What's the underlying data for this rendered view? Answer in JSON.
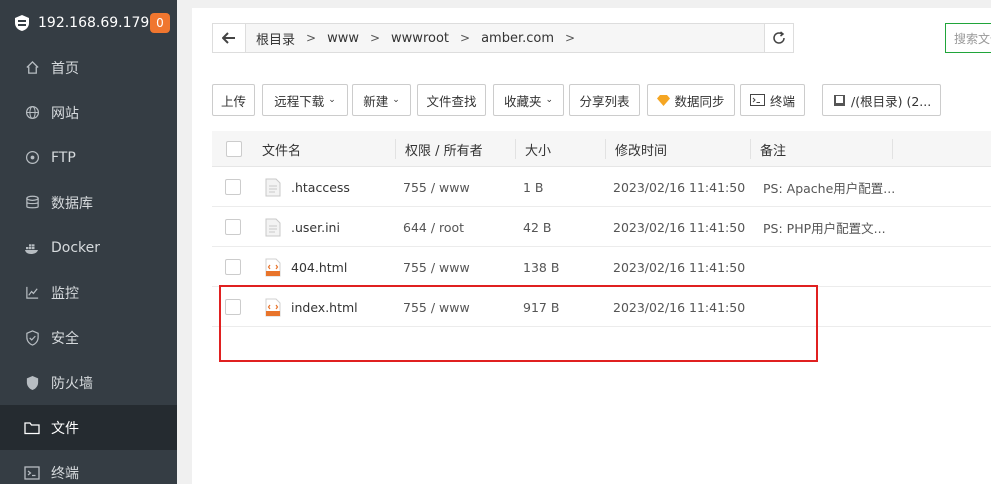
{
  "sidebar": {
    "ip": "192.168.69.179",
    "badge": "0",
    "items": [
      {
        "label": "首页",
        "icon": "home-icon"
      },
      {
        "label": "网站",
        "icon": "globe-icon"
      },
      {
        "label": "FTP",
        "icon": "ftp-icon"
      },
      {
        "label": "数据库",
        "icon": "database-icon"
      },
      {
        "label": "Docker",
        "icon": "docker-icon"
      },
      {
        "label": "监控",
        "icon": "monitor-icon"
      },
      {
        "label": "安全",
        "icon": "shield-icon"
      },
      {
        "label": "防火墙",
        "icon": "firewall-icon"
      },
      {
        "label": "文件",
        "icon": "folder-icon",
        "active": true
      },
      {
        "label": "终端",
        "icon": "terminal-icon"
      }
    ]
  },
  "path": {
    "crumbs": [
      "根目录",
      "www",
      "wwwroot",
      "amber.com"
    ]
  },
  "search": {
    "placeholder": "搜索文件"
  },
  "toolbar": {
    "upload": "上传",
    "remote_download": "远程下载",
    "new": "新建",
    "file_search": "文件查找",
    "favorites": "收藏夹",
    "share_list": "分享列表",
    "data_sync": "数据同步",
    "terminal": "终端",
    "disk": "/(根目录) (2..."
  },
  "table": {
    "headers": {
      "name": "文件名",
      "perm": "权限 / 所有者",
      "size": "大小",
      "mtime": "修改时间",
      "note": "备注"
    },
    "rows": [
      {
        "name": ".htaccess",
        "perm": "755 / www",
        "size": "1 B",
        "mtime": "2023/02/16 11:41:50",
        "note": "PS: Apache用户配置...",
        "type": "text"
      },
      {
        "name": ".user.ini",
        "perm": "644 / root",
        "size": "42 B",
        "mtime": "2023/02/16 11:41:50",
        "note": "PS: PHP用户配置文...",
        "type": "text"
      },
      {
        "name": "404.html",
        "perm": "755 / www",
        "size": "138 B",
        "mtime": "2023/02/16 11:41:50",
        "note": "",
        "type": "html"
      },
      {
        "name": "index.html",
        "perm": "755 / www",
        "size": "917 B",
        "mtime": "2023/02/16 11:41:50",
        "note": "",
        "type": "html"
      }
    ]
  },
  "colors": {
    "accent": "#20a53a",
    "badge": "#f0762f",
    "highlight": "#e02020",
    "sidebar": "#353d44"
  }
}
